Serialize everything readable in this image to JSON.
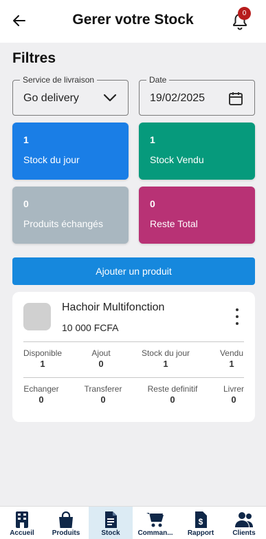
{
  "header": {
    "title": "Gerer votre Stock",
    "notification_count": "0"
  },
  "filters": {
    "title": "Filtres",
    "service": {
      "label": "Service de livraison",
      "value": "Go delivery"
    },
    "date": {
      "label": "Date",
      "value": "19/02/2025"
    }
  },
  "stats": [
    {
      "value": "1",
      "label": "Stock du jour",
      "color": "#1a7ee6"
    },
    {
      "value": "1",
      "label": "Stock Vendu",
      "color": "#069a7c"
    },
    {
      "value": "0",
      "label": "Produits échangés",
      "color": "#a9b7c0"
    },
    {
      "value": "0",
      "label": "Reste Total",
      "color": "#b83275"
    }
  ],
  "add_button": "Ajouter un produit",
  "product": {
    "name": "Hachoir Multifonction",
    "price": "10 000 FCFA",
    "row1": [
      {
        "label": "Disponible",
        "value": "1"
      },
      {
        "label": "Ajout",
        "value": "0"
      },
      {
        "label": "Stock du jour",
        "value": "1"
      },
      {
        "label": "Vendu",
        "value": "1"
      }
    ],
    "row2": [
      {
        "label": "Echanger",
        "value": "0"
      },
      {
        "label": "Transferer",
        "value": "0"
      },
      {
        "label": "Reste definitif",
        "value": "0"
      },
      {
        "label": "Livrer",
        "value": "0"
      }
    ]
  },
  "nav": [
    {
      "label": "Accueil",
      "icon": "building-icon"
    },
    {
      "label": "Produits",
      "icon": "shopping-bag-icon"
    },
    {
      "label": "Stock",
      "icon": "document-icon",
      "active": true
    },
    {
      "label": "Comman...",
      "icon": "cart-icon"
    },
    {
      "label": "Rapport",
      "icon": "invoice-dollar-icon"
    },
    {
      "label": "Clients",
      "icon": "users-icon"
    }
  ],
  "colors": {
    "accent": "#1688dd",
    "nav_text": "#0f2748",
    "badge": "#b71c1c"
  }
}
